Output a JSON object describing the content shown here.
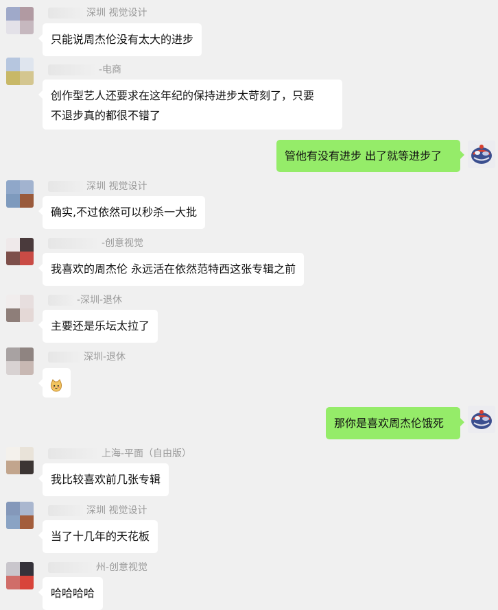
{
  "messages": [
    {
      "side": "left",
      "sender": "深圳 视觉设计",
      "lines": [
        "只能说周杰伦没有太大的进步"
      ]
    },
    {
      "side": "left",
      "sender": "-电商",
      "lines": [
        "创作型艺人还要求在这年纪的保持进步太苛刻了，只要",
        "不退步真的都很不错了"
      ]
    },
    {
      "side": "right",
      "lines": [
        "管他有没有进步 出了就等进步了"
      ]
    },
    {
      "side": "left",
      "sender": "深圳 视觉设计",
      "lines": [
        "确实,不过依然可以秒杀一大批"
      ]
    },
    {
      "side": "left",
      "sender": "-创意视觉",
      "lines": [
        "我喜欢的周杰伦 永远活在依然范特西这张专辑之前"
      ]
    },
    {
      "side": "left",
      "sender": "-深圳-退休",
      "lines": [
        "主要还是乐坛太拉了"
      ]
    },
    {
      "side": "left",
      "sender": "深圳-退休",
      "emoji": "cat-face-emoji"
    },
    {
      "side": "right",
      "lines": [
        "那你是喜欢周杰伦饿死"
      ]
    },
    {
      "side": "left",
      "sender": "上海-平面（自由版）",
      "lines": [
        "我比较喜欢前几张专辑"
      ]
    },
    {
      "side": "left",
      "sender": "深圳 视觉设计",
      "lines": [
        "当了十几年的天花板"
      ]
    },
    {
      "side": "left",
      "sender": "州-创意视觉",
      "lines": [
        "哈哈哈哈"
      ]
    }
  ],
  "colors": {
    "background": "#f0f0f0",
    "self_bubble": "#95ec69",
    "other_bubble": "#ffffff",
    "name_text": "#9a9a9a"
  }
}
